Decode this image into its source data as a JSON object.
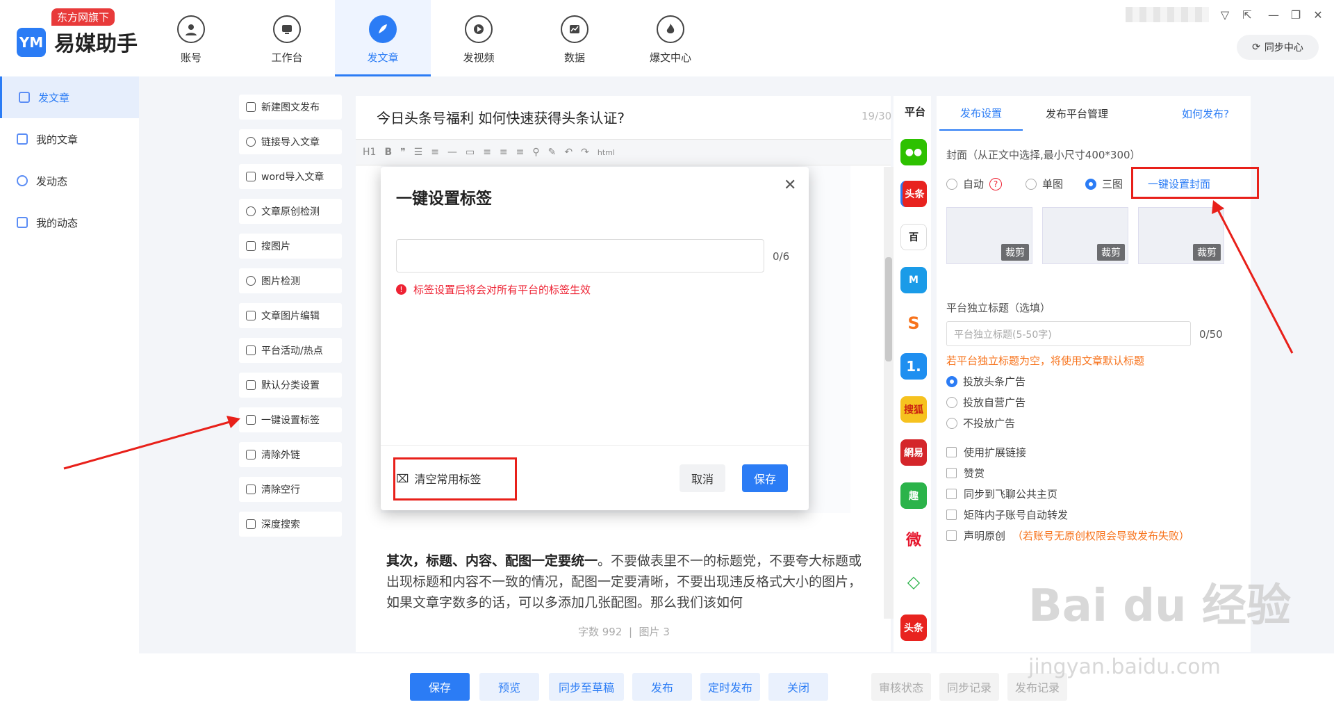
{
  "brand": {
    "badge": "东方网旗下",
    "logo_text": "YM",
    "name": "易媒助手"
  },
  "nav": [
    {
      "label": "账号",
      "icon": "user-icon"
    },
    {
      "label": "工作台",
      "icon": "monitor-icon"
    },
    {
      "label": "发文章",
      "icon": "feather-icon",
      "active": true
    },
    {
      "label": "发视频",
      "icon": "play-icon"
    },
    {
      "label": "数据",
      "icon": "chart-icon"
    },
    {
      "label": "爆文中心",
      "icon": "fire-icon"
    }
  ],
  "sync": {
    "label": "同步中心"
  },
  "sidebar": [
    {
      "label": "发文章",
      "active": true
    },
    {
      "label": "我的文章"
    },
    {
      "label": "发动态"
    },
    {
      "label": "我的动态"
    }
  ],
  "tools": [
    "新建图文发布",
    "链接导入文章",
    "word导入文章",
    "文章原创检测",
    "搜图片",
    "图片检测",
    "文章图片编辑",
    "平台活动/热点",
    "默认分类设置",
    "一键设置标签",
    "清除外链",
    "清除空行",
    "深度搜索"
  ],
  "editor": {
    "title": "今日头条号福利 如何快速获得头条认证?",
    "title_count": "19/30",
    "toolbar_html": "html",
    "para_bold": "其次，标题、内容、配图一定要统一",
    "para_rest": "。不要做表里不一的标题党，不要夸大标题或出现标题和内容不一致的情况，配图一定要清晰，不要出现违反格式大小的图片，如果文章字数多的话，可以多添加几张配图。那么我们该如何",
    "word_count": "字数 992",
    "image_count": "图片 3"
  },
  "modal": {
    "title": "一键设置标签",
    "counter": "0/6",
    "warning": "标签设置后将会对所有平台的标签生效",
    "clear": "清空常用标签",
    "cancel": "取消",
    "save": "保存"
  },
  "platforms": {
    "header": "平台",
    "items": [
      {
        "name": "wechat-icon",
        "text": "",
        "color": "#2dc100"
      },
      {
        "name": "toutiao-icon",
        "text": "头条",
        "color": "#e8231f"
      },
      {
        "name": "baijia-icon",
        "text": "百",
        "color": "#ffffff"
      },
      {
        "name": "dayu-icon",
        "text": "M",
        "color": "#1a9be8"
      },
      {
        "name": "sohu-s-icon",
        "text": "S",
        "color": "#f7731c"
      },
      {
        "name": "yidian-icon",
        "text": "1.",
        "color": "#1f8ff0"
      },
      {
        "name": "sohu-icon",
        "text": "搜狐",
        "color": "#f6c21f"
      },
      {
        "name": "netease-icon",
        "text": "網易",
        "color": "#d4252a"
      },
      {
        "name": "qutoutiao-icon",
        "text": "趣",
        "color": "#2bb34a"
      },
      {
        "name": "weibo-icon",
        "text": "微",
        "color": "#e6162d"
      },
      {
        "name": "aiqiyi-icon",
        "text": "◇",
        "color": "#2bb34a"
      },
      {
        "name": "toutiao2-icon",
        "text": "头条",
        "color": "#e8231f"
      }
    ]
  },
  "right": {
    "tabs": [
      "发布设置",
      "发布平台管理"
    ],
    "help": "如何发布?",
    "cover_label": "封面（从正文中选择,最小尺寸400*300）",
    "cover_options": [
      "自动",
      "单图",
      "三图"
    ],
    "cover_selected": "三图",
    "cover_btn": "一键设置封面",
    "crop": "裁剪",
    "title_label": "平台独立标题（选填）",
    "title_placeholder": "平台独立标题(5-50字)",
    "title_counter": "0/50",
    "title_hint": "若平台独立标题为空，将使用文章默认标题",
    "ad_options": [
      "投放头条广告",
      "投放自营广告",
      "不投放广告"
    ],
    "ad_selected": "投放头条广告",
    "checks": [
      "使用扩展链接",
      "赞赏",
      "同步到飞聊公共主页",
      "矩阵内子账号自动转发",
      "声明原创"
    ],
    "original_note": "（若账号无原创权限会导致发布失败）"
  },
  "bottom": {
    "buttons": [
      "保存",
      "预览",
      "同步至草稿",
      "发布",
      "定时发布",
      "关闭"
    ],
    "gray_buttons": [
      "审核状态",
      "同步记录",
      "发布记录"
    ]
  },
  "watermark": {
    "main": "Bai du 经验",
    "sub": "jingyan.baidu.com"
  },
  "colors": {
    "accent": "#2b7cf5",
    "warning": "#e8201a"
  }
}
